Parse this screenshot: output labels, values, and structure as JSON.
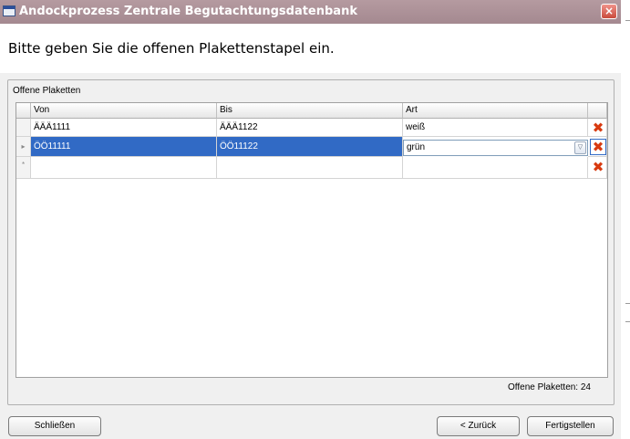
{
  "window": {
    "title": "Andockprozess Zentrale Begutachtungsdatenbank",
    "close_glyph": "×"
  },
  "header": {
    "instruction": "Bitte geben Sie die offenen Plakettenstapel ein."
  },
  "group": {
    "label": "Offene Plaketten"
  },
  "grid": {
    "columns": [
      "Von",
      "Bis",
      "Art"
    ],
    "rows": [
      {
        "von": "ÄÄÄ1111",
        "bis": "ÄÄÄ1122",
        "art": "weiß"
      },
      {
        "von": "ÖÖ11111",
        "bis": "ÖÖ11122",
        "art": "grün"
      }
    ],
    "selected_row_marker": "▸",
    "new_row_marker": "*",
    "combo_arrow": "▽",
    "delete_glyph": "✖"
  },
  "footer": {
    "count_text": "Offene Plaketten: 24"
  },
  "buttons": {
    "close": "Schließen",
    "back": "< Zurück",
    "finish": "Fertigstellen"
  },
  "colors": {
    "titlebar": "#a9909a",
    "selection": "#316ac5",
    "delete_icon": "#d83a10"
  }
}
